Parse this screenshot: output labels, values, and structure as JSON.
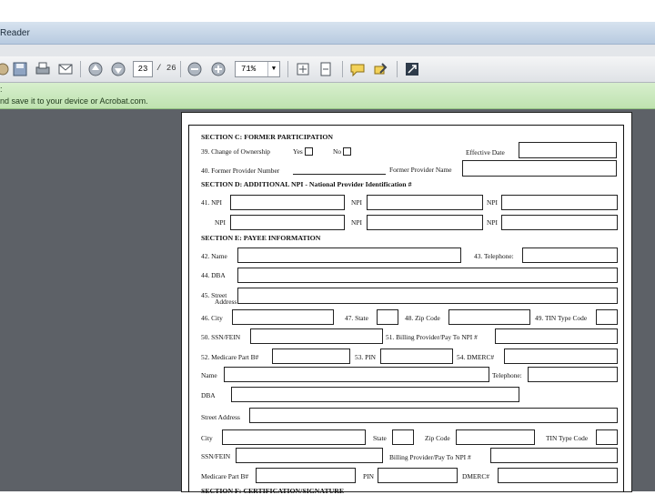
{
  "window": {
    "title": "Reader"
  },
  "toolbar": {
    "page_current": "23",
    "page_separator": "/",
    "page_total": "26",
    "zoom": "71%"
  },
  "notice": {
    "line1": ":",
    "line2": "nd save it to your device or Acrobat.com."
  },
  "form": {
    "sec_c": "SECTION C:  FORMER PARTICIPATION",
    "f39": "39.  Change of Ownership",
    "yes": "Yes",
    "no": "No",
    "effective_date": "Effective Date",
    "f40": "40.  Former Provider Number",
    "former_provider_name": "Former Provider Name",
    "sec_d": "SECTION D:  ADDITIONAL NPI - National Provider Identification #",
    "f41": "41.  NPI",
    "npi": "NPI",
    "sec_e": "SECTION E:  PAYEE INFORMATION",
    "f42": "42.  Name",
    "f43": "43.  Telephone:",
    "f44": "44.  DBA",
    "f45a": "45.  Street",
    "f45b": "Address",
    "f46": "46.  City",
    "f47": "47.  State",
    "f48": "48.  Zip Code",
    "f49": "49.  TIN Type Code",
    "f50": "50.  SSN/FEIN",
    "f51": "51.  Billing Provider/Pay To NPI #",
    "f52": "52.  Medicare Part B#",
    "f53": "53.  PIN",
    "f54": "54.  DMERC#",
    "name": "Name",
    "telephone": "Telephone:",
    "dba": "DBA",
    "street": "Street Address",
    "city": "City",
    "state": "State",
    "zip": "Zip Code",
    "tin": "TIN Type Code",
    "ssn": "SSN/FEIN",
    "billing": "Billing Provider/Pay To NPI #",
    "medicare": "Medicare Part B#",
    "pin": "PIN",
    "dmerc": "DMERC#",
    "sec_f": "SECTION F:  CERTIFICATION/SIGNATURE"
  }
}
